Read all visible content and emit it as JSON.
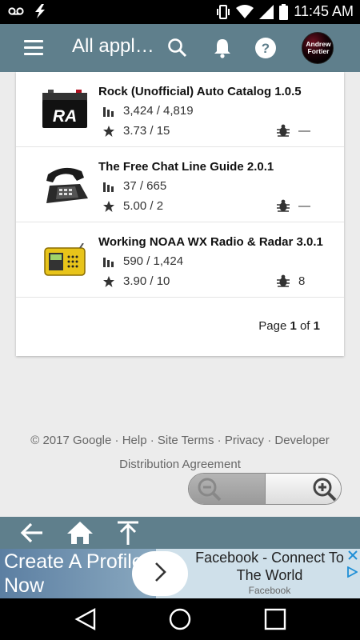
{
  "status_bar": {
    "time": "11:45 AM",
    "left_icons": [
      "voicemail-icon",
      "lightning-icon"
    ],
    "right_icons": [
      "vibrate-icon",
      "wifi-icon",
      "signal-icon",
      "battery-icon"
    ]
  },
  "app_bar": {
    "title": "All applications",
    "avatar_text": "Andrew Fortier",
    "icons": [
      "menu-icon",
      "search-icon",
      "bell-icon",
      "help-icon"
    ]
  },
  "apps": [
    {
      "name": "Rock (Unofficial) Auto Catalog 1.0.5",
      "installs": "3,424 / 4,819",
      "rating": "3.73 / 15",
      "bugs": "—"
    },
    {
      "name": "The Free Chat Line Guide 2.0.1",
      "installs": "37 / 665",
      "rating": "5.00 / 2",
      "bugs": "—"
    },
    {
      "name": "Working NOAA WX Radio & Radar 3.0.1",
      "installs": "590 / 1,424",
      "rating": "3.90 / 10",
      "bugs": "8"
    }
  ],
  "pager": {
    "prefix": "Page ",
    "current": "1",
    "of": " of ",
    "total": "1"
  },
  "footer": {
    "copyright": "© 2017 Google",
    "links": [
      "Help",
      "Site Terms",
      "Privacy",
      "Developer Distribution Agreement"
    ],
    "separator": " · "
  },
  "zoom": {
    "icons": [
      "zoom-out-icon",
      "zoom-in-icon"
    ]
  },
  "toolbar": {
    "icons": [
      "back-arrow-icon",
      "home-icon",
      "scroll-top-icon"
    ]
  },
  "ad": {
    "left_text": "Create A Profile Now",
    "title": "Facebook - Connect To The World",
    "sponsor": "Facebook"
  },
  "nav_bar": {
    "icons": [
      "back-triangle-icon",
      "home-circle-icon",
      "recents-square-icon"
    ]
  },
  "colors": {
    "app_bar": "#5f7f8c",
    "background": "#ececec",
    "card": "#ffffff"
  }
}
